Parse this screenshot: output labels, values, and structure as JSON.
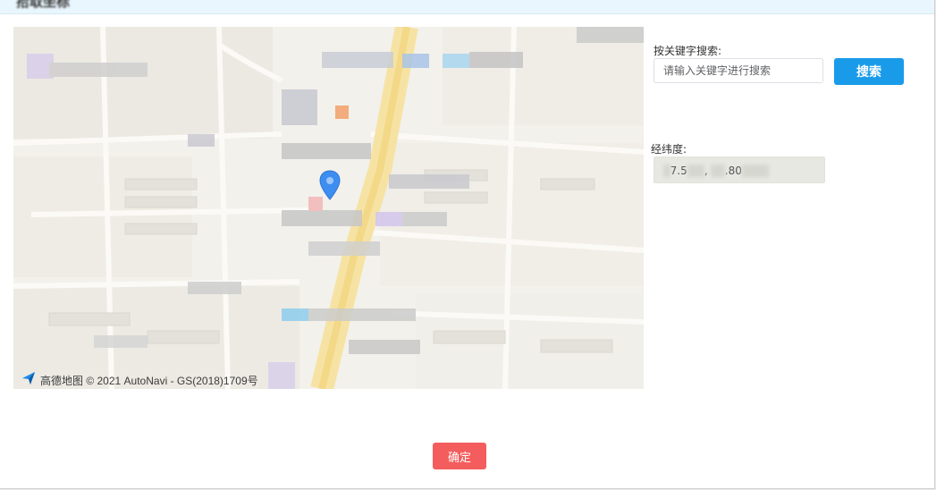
{
  "dialog": {
    "title": "拾取坐标"
  },
  "map": {
    "copyright": "高德地图 © 2021 AutoNavi - GS(2018)1709号"
  },
  "search": {
    "label": "按关键字搜索:",
    "placeholder": "请输入关键字进行搜索",
    "button_label": "搜索"
  },
  "coordinates": {
    "label": "经纬度:",
    "value_part1": "1",
    "value_part2": "7.5",
    "value_part3": ", ",
    "value_part4": ".80"
  },
  "footer": {
    "confirm_label": "确定"
  },
  "colors": {
    "primary": "#1a9bea",
    "danger": "#f45d5d",
    "map_road": "#f5dc8f"
  }
}
